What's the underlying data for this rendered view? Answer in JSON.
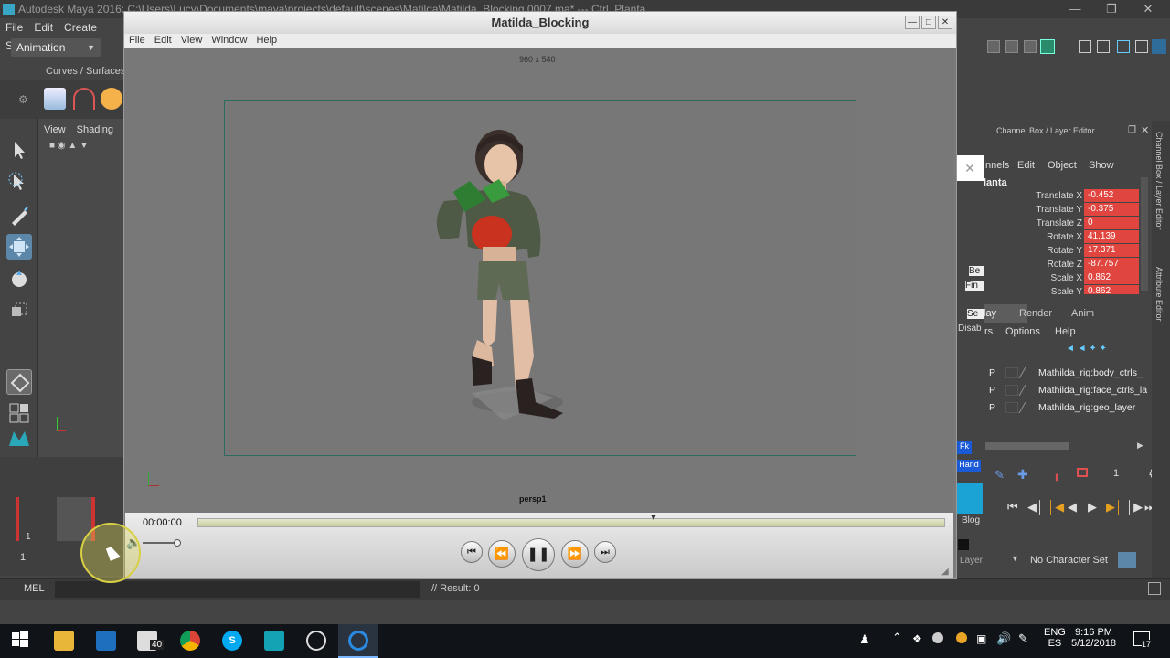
{
  "maya": {
    "title": "Autodesk Maya 2016: C:\\Users\\Lucy\\Documents\\maya\\projects\\default\\scenes\\Matilda\\Matilda_Blocking.0007.ma* --- Ctrl_Planta",
    "menu": [
      "File",
      "Edit",
      "Create",
      "Sel"
    ],
    "mode": "Animation",
    "shelf_tab": "Curves / Surfaces",
    "viewport_menu": [
      "View",
      "Shading"
    ],
    "mel_label": "MEL",
    "result": "// Result: 0",
    "timeline_start": "1",
    "timeline_frame": "1"
  },
  "channel_box": {
    "title": "Channel Box / Layer Editor",
    "menu": [
      "nnels",
      "Edit",
      "Object",
      "Show"
    ],
    "object_name": "lanta",
    "attributes": [
      {
        "label": "Translate X",
        "value": "-0.452"
      },
      {
        "label": "Translate Y",
        "value": "-0.375"
      },
      {
        "label": "Translate Z",
        "value": "0"
      },
      {
        "label": "Rotate X",
        "value": "41.139"
      },
      {
        "label": "Rotate Y",
        "value": "17.371"
      },
      {
        "label": "Rotate Z",
        "value": "-87.757"
      },
      {
        "label": "Scale X",
        "value": "0.862"
      },
      {
        "label": "Scale Y",
        "value": "0.862"
      }
    ],
    "layer_tabs": [
      "lay",
      "Render",
      "Anim"
    ],
    "layer_menu": [
      "rs",
      "Options",
      "Help"
    ],
    "layers": [
      {
        "flag": "P",
        "name": "Mathilda_rig:body_ctrls_"
      },
      {
        "flag": "P",
        "name": "Mathilda_rig:face_ctrls_la"
      },
      {
        "flag": "P",
        "name": "Mathilda_rig:geo_layer"
      }
    ],
    "frame_value": "1",
    "character_set": "No Character Set",
    "side_tabs": [
      "Channel Box / Layer Editor",
      "Attribute Editor"
    ],
    "clipped_labels": [
      "Be",
      "Fin",
      "Se",
      "Disab",
      "Fk",
      "Hand",
      "Blog",
      "Layer"
    ]
  },
  "playblast": {
    "title": "Matilda_Blocking",
    "menu": [
      "File",
      "Edit",
      "View",
      "Window",
      "Help"
    ],
    "resolution": "960 x 540",
    "camera": "persp1",
    "time": "00:00:00",
    "progress": 0.61
  },
  "taskbar": {
    "lang": "ENG",
    "lang2": "ES",
    "time": "9:16 PM",
    "date": "5/12/2018",
    "mail_badge": "40",
    "notif_badge": "17"
  },
  "colors": {
    "attr_highlight": "#e0463f",
    "maya_accent": "#3aa6c6",
    "cursor_highlight": "#e8e05a"
  }
}
